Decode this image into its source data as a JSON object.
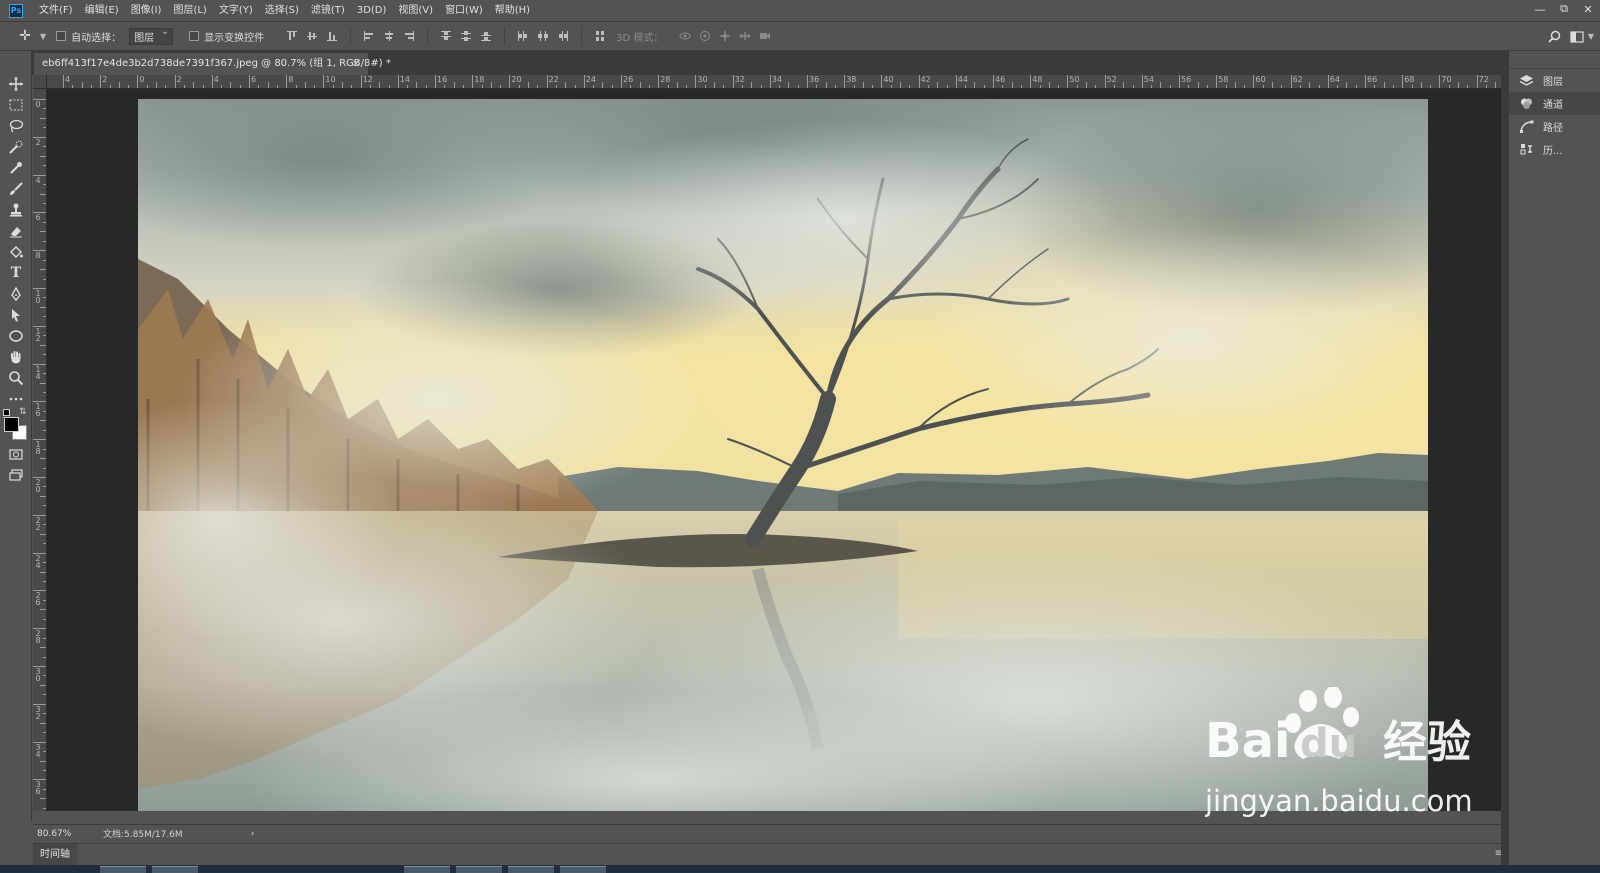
{
  "app": {
    "logo_text": "Ps",
    "menus": [
      "文件(F)",
      "编辑(E)",
      "图像(I)",
      "图层(L)",
      "文字(Y)",
      "选择(S)",
      "滤镜(T)",
      "3D(D)",
      "视图(V)",
      "窗口(W)",
      "帮助(H)"
    ]
  },
  "options": {
    "auto_select_label": "自动选择：",
    "auto_select_target": "图层",
    "show_transform_label": "显示变换控件",
    "mode_3d_label": "3D 模式："
  },
  "document": {
    "tab_title": "eb6ff413f17e4de3b2d738de7391f367.jpeg @ 80.7% (组 1, RGB/8#) *",
    "close_glyph": "×"
  },
  "rulers": {
    "h_labels": [
      "4",
      "2",
      "0",
      "2",
      "4",
      "6",
      "8",
      "10",
      "12",
      "14",
      "16",
      "18",
      "20",
      "22",
      "24",
      "26",
      "28",
      "30",
      "32",
      "34",
      "36",
      "38",
      "40",
      "42",
      "44",
      "46",
      "48",
      "50",
      "52",
      "54",
      "56",
      "58",
      "60",
      "62",
      "64",
      "66",
      "68",
      "70",
      "72"
    ],
    "v_labels": [
      "0",
      "2",
      "4",
      "6",
      "8",
      "10",
      "12",
      "14",
      "16",
      "18",
      "20",
      "22",
      "24",
      "26",
      "28",
      "30",
      "32",
      "34",
      "36"
    ]
  },
  "status": {
    "zoom": "80.67%",
    "doc_size": "文档:5.85M/17.6M",
    "arrow": "›"
  },
  "timeline": {
    "tab_label": "时间轴"
  },
  "panels": [
    {
      "label": "图层",
      "icon": "layers-icon",
      "active": false
    },
    {
      "label": "通道",
      "icon": "channels-icon",
      "active": true
    },
    {
      "label": "路径",
      "icon": "paths-icon",
      "active": false
    },
    {
      "label": "历...",
      "icon": "history-icon",
      "active": false
    }
  ],
  "watermark": {
    "brand_latin": "Bai",
    "brand_du": "du",
    "brand_cn": "经验",
    "url": "jingyan.baidu.com"
  },
  "colors": {
    "ui_bg": "#535353",
    "canvas_bg": "#282828",
    "foreground": "#000000",
    "background": "#ffffff"
  }
}
